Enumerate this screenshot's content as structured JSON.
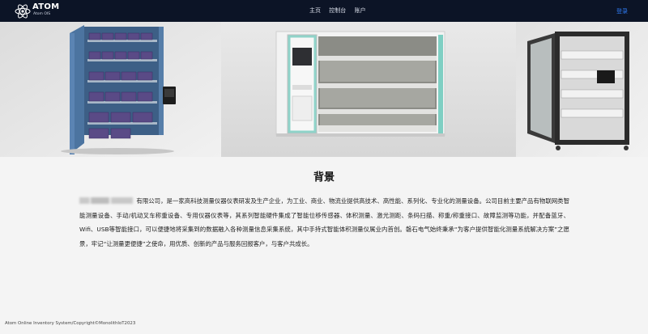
{
  "brand": {
    "name": "ATOM",
    "subtitle": "Atom OIS"
  },
  "nav": {
    "items": [
      "主页",
      "控制台",
      "账户"
    ],
    "login": "登录"
  },
  "carousel": {
    "slide_count": 4,
    "active_index": 1
  },
  "content": {
    "heading": "背景",
    "paragraph": "有限公司，是一家高科技测量仪器仪表研发及生产企业，为工业、商业、物流业提供高技术、高性能、系列化、专业化的测量设备。公司目前主要产品有物联网类智能测量设备、手动/机动叉车称重设备、专用仪器仪表等，其系列智能硬件集成了智能位移传感器、体积测量、激光测距、条码扫描、称重/称重接口、故障监测等功能，并配备蓝牙、Wifi、USB等智能接口，可以便捷地将采集到的数据融入各种测量信息采集系统，其中手持式智能体积测量仪属业内首创。磐石电气始终秉承“为客户提供智能化测量系统解决方案”之愿景，牢记“让测量更便捷”之使命，用优质、创新的产品与服务回报客户，与客户共成长。"
  },
  "footer": {
    "text": "Atom Online Inventory System/Copyright©MonolithIoT2023"
  },
  "colors": {
    "navbar": "#0c1426",
    "login_link": "#2f7cf6",
    "page_bg": "#f4f4f4"
  }
}
